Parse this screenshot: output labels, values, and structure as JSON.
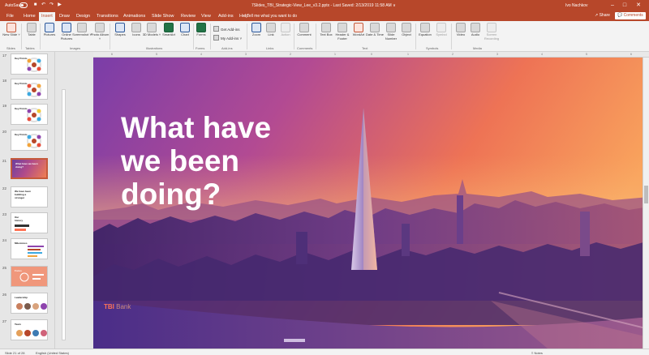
{
  "titlebar": {
    "autosave": "AutoSave",
    "toggle_state": "Off",
    "document": "7Slides_TBI_Strategic-View_Lee_v3.2.pptx  -  Last Saved: 2/13/2019 11:58 AM  ∨",
    "user": "Ivo Nachkov",
    "minimize": "–",
    "restore": "□",
    "close": "✕",
    "qat_save": "■",
    "qat_undo": "↶",
    "qat_redo": "↷",
    "qat_slideshow": "▶"
  },
  "tabs": [
    "File",
    "Home",
    "Insert",
    "Draw",
    "Design",
    "Transitions",
    "Animations",
    "Slide Show",
    "Review",
    "View",
    "Add-ins",
    "Help"
  ],
  "active_tab": "Insert",
  "tell_me": "○  Tell me what you want to do",
  "share": "↗ Share",
  "comments": "💬 Comments",
  "ribbon": {
    "slides": {
      "new_slide": "New Slide ˅",
      "group": "Slides"
    },
    "tables": {
      "table": "Table",
      "group": "Tables"
    },
    "images": {
      "pictures": "Pictures",
      "online_pictures": "Online Pictures",
      "screenshot": "Screenshot ˅",
      "photo_album": "Photo Album ˅",
      "group": "Images"
    },
    "illustrations": {
      "shapes": "Shapes",
      "icons": "Icons",
      "models": "3D Models ˅",
      "smartart": "SmartArt",
      "chart": "Chart",
      "group": "Illustrations"
    },
    "forms": {
      "forms": "Forms",
      "group": "Forms"
    },
    "addins": {
      "get_addins": "Get Add-ins",
      "my_addins": "My Add-ins ˅",
      "group": "Add-ins"
    },
    "links": {
      "zoom": "Zoom",
      "link": "Link",
      "action": "Action",
      "group": "Links"
    },
    "comments": {
      "comment": "Comment",
      "group": "Comments"
    },
    "text": {
      "text_box": "Text Box",
      "header_footer": "Header & Footer",
      "wordart": "WordArt",
      "date_time": "Date & Time",
      "slide_number": "Slide Number",
      "object": "Object",
      "group": "Text"
    },
    "symbols": {
      "equation": "Equation",
      "symbol": "Symbol",
      "group": "Symbols"
    },
    "media": {
      "video": "Video",
      "audio": "Audio",
      "screen_recording": "Screen Recording",
      "group": "Media"
    }
  },
  "ruler_ticks": [
    "6",
    "5",
    "4",
    "3",
    "2",
    "1",
    "0",
    "1",
    "2",
    "3",
    "4",
    "5",
    "6"
  ],
  "thumbnails": [
    {
      "num": "17",
      "title": "Key Points"
    },
    {
      "num": "18",
      "title": "Key Points"
    },
    {
      "num": "19",
      "title": "Key Points"
    },
    {
      "num": "20",
      "title": "Key Points"
    },
    {
      "num": "21",
      "title": "What have we been doing?"
    },
    {
      "num": "22",
      "title": "We have been\nbuilding a\nstronger"
    },
    {
      "num": "23",
      "title": "Our\nhistory"
    },
    {
      "num": "24",
      "title": "Milestones"
    },
    {
      "num": "25",
      "title": "Focus"
    },
    {
      "num": "26",
      "title": "Leadership"
    },
    {
      "num": "27",
      "title": "Team"
    }
  ],
  "slide": {
    "title_line1": "What have",
    "title_line2": "we been",
    "title_line3": "doing?",
    "brand_accent": "TBI",
    "brand_rest": " Bank"
  },
  "status": {
    "slide_counter": "Slide 21 of 28",
    "language": "English (United States)",
    "notes": "≡ Notes"
  },
  "colors": {
    "accent": "#b7472a",
    "brand_orange": "#ff7355"
  }
}
